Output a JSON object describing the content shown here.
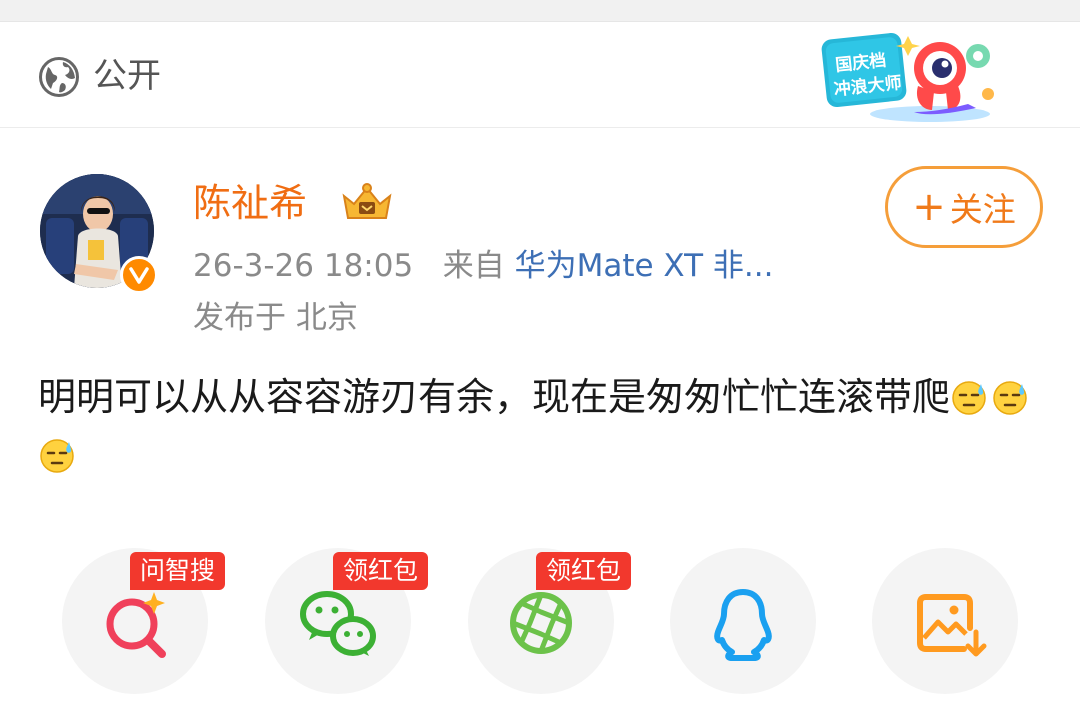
{
  "visibility": {
    "label": "公开",
    "icon": "globe-icon"
  },
  "badge": {
    "line1": "国庆档",
    "line2": "冲浪大师"
  },
  "post": {
    "author": "陈祉希",
    "date": "26-3-26 18:05",
    "from_label": "来自",
    "device": "华为Mate XT 非...",
    "location": "发布于 北京",
    "text": "明明可以从从容容游刃有余，现在是匆匆忙忙连滚带爬",
    "emoji_count": 3
  },
  "follow": {
    "plus": "+",
    "label": "关注"
  },
  "share": {
    "items": [
      {
        "name": "ai-search",
        "icon": "ai-search-icon",
        "tag": "问智搜"
      },
      {
        "name": "wechat",
        "icon": "wechat-icon",
        "tag": "领红包"
      },
      {
        "name": "moments",
        "icon": "moments-icon",
        "tag": "领红包"
      },
      {
        "name": "qq",
        "icon": "qq-icon",
        "tag": ""
      },
      {
        "name": "save-image",
        "icon": "save-image-icon",
        "tag": ""
      }
    ]
  },
  "colors": {
    "username": "#f06d13",
    "device_link": "#3d6fb5",
    "follow_border": "#f59e3a",
    "tag_bg": "#f2382d",
    "wechat": "#3cb034",
    "moments": "#6cc24a",
    "qq": "#1aa0f0",
    "save": "#ff9a1f",
    "search": "#f0405b"
  }
}
